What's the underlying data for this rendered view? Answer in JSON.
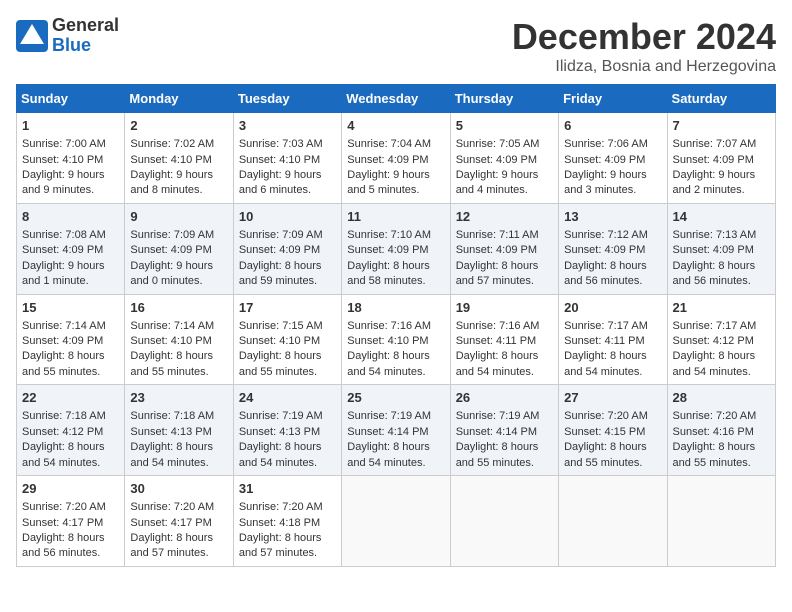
{
  "logo": {
    "general": "General",
    "blue": "Blue"
  },
  "header": {
    "month": "December 2024",
    "location": "Ilidza, Bosnia and Herzegovina"
  },
  "weekdays": [
    "Sunday",
    "Monday",
    "Tuesday",
    "Wednesday",
    "Thursday",
    "Friday",
    "Saturday"
  ],
  "weeks": [
    [
      {
        "day": 1,
        "lines": [
          "Sunrise: 7:00 AM",
          "Sunset: 4:10 PM",
          "Daylight: 9 hours",
          "and 9 minutes."
        ]
      },
      {
        "day": 2,
        "lines": [
          "Sunrise: 7:02 AM",
          "Sunset: 4:10 PM",
          "Daylight: 9 hours",
          "and 8 minutes."
        ]
      },
      {
        "day": 3,
        "lines": [
          "Sunrise: 7:03 AM",
          "Sunset: 4:10 PM",
          "Daylight: 9 hours",
          "and 6 minutes."
        ]
      },
      {
        "day": 4,
        "lines": [
          "Sunrise: 7:04 AM",
          "Sunset: 4:09 PM",
          "Daylight: 9 hours",
          "and 5 minutes."
        ]
      },
      {
        "day": 5,
        "lines": [
          "Sunrise: 7:05 AM",
          "Sunset: 4:09 PM",
          "Daylight: 9 hours",
          "and 4 minutes."
        ]
      },
      {
        "day": 6,
        "lines": [
          "Sunrise: 7:06 AM",
          "Sunset: 4:09 PM",
          "Daylight: 9 hours",
          "and 3 minutes."
        ]
      },
      {
        "day": 7,
        "lines": [
          "Sunrise: 7:07 AM",
          "Sunset: 4:09 PM",
          "Daylight: 9 hours",
          "and 2 minutes."
        ]
      }
    ],
    [
      {
        "day": 8,
        "lines": [
          "Sunrise: 7:08 AM",
          "Sunset: 4:09 PM",
          "Daylight: 9 hours",
          "and 1 minute."
        ]
      },
      {
        "day": 9,
        "lines": [
          "Sunrise: 7:09 AM",
          "Sunset: 4:09 PM",
          "Daylight: 9 hours",
          "and 0 minutes."
        ]
      },
      {
        "day": 10,
        "lines": [
          "Sunrise: 7:09 AM",
          "Sunset: 4:09 PM",
          "Daylight: 8 hours",
          "and 59 minutes."
        ]
      },
      {
        "day": 11,
        "lines": [
          "Sunrise: 7:10 AM",
          "Sunset: 4:09 PM",
          "Daylight: 8 hours",
          "and 58 minutes."
        ]
      },
      {
        "day": 12,
        "lines": [
          "Sunrise: 7:11 AM",
          "Sunset: 4:09 PM",
          "Daylight: 8 hours",
          "and 57 minutes."
        ]
      },
      {
        "day": 13,
        "lines": [
          "Sunrise: 7:12 AM",
          "Sunset: 4:09 PM",
          "Daylight: 8 hours",
          "and 56 minutes."
        ]
      },
      {
        "day": 14,
        "lines": [
          "Sunrise: 7:13 AM",
          "Sunset: 4:09 PM",
          "Daylight: 8 hours",
          "and 56 minutes."
        ]
      }
    ],
    [
      {
        "day": 15,
        "lines": [
          "Sunrise: 7:14 AM",
          "Sunset: 4:09 PM",
          "Daylight: 8 hours",
          "and 55 minutes."
        ]
      },
      {
        "day": 16,
        "lines": [
          "Sunrise: 7:14 AM",
          "Sunset: 4:10 PM",
          "Daylight: 8 hours",
          "and 55 minutes."
        ]
      },
      {
        "day": 17,
        "lines": [
          "Sunrise: 7:15 AM",
          "Sunset: 4:10 PM",
          "Daylight: 8 hours",
          "and 55 minutes."
        ]
      },
      {
        "day": 18,
        "lines": [
          "Sunrise: 7:16 AM",
          "Sunset: 4:10 PM",
          "Daylight: 8 hours",
          "and 54 minutes."
        ]
      },
      {
        "day": 19,
        "lines": [
          "Sunrise: 7:16 AM",
          "Sunset: 4:11 PM",
          "Daylight: 8 hours",
          "and 54 minutes."
        ]
      },
      {
        "day": 20,
        "lines": [
          "Sunrise: 7:17 AM",
          "Sunset: 4:11 PM",
          "Daylight: 8 hours",
          "and 54 minutes."
        ]
      },
      {
        "day": 21,
        "lines": [
          "Sunrise: 7:17 AM",
          "Sunset: 4:12 PM",
          "Daylight: 8 hours",
          "and 54 minutes."
        ]
      }
    ],
    [
      {
        "day": 22,
        "lines": [
          "Sunrise: 7:18 AM",
          "Sunset: 4:12 PM",
          "Daylight: 8 hours",
          "and 54 minutes."
        ]
      },
      {
        "day": 23,
        "lines": [
          "Sunrise: 7:18 AM",
          "Sunset: 4:13 PM",
          "Daylight: 8 hours",
          "and 54 minutes."
        ]
      },
      {
        "day": 24,
        "lines": [
          "Sunrise: 7:19 AM",
          "Sunset: 4:13 PM",
          "Daylight: 8 hours",
          "and 54 minutes."
        ]
      },
      {
        "day": 25,
        "lines": [
          "Sunrise: 7:19 AM",
          "Sunset: 4:14 PM",
          "Daylight: 8 hours",
          "and 54 minutes."
        ]
      },
      {
        "day": 26,
        "lines": [
          "Sunrise: 7:19 AM",
          "Sunset: 4:14 PM",
          "Daylight: 8 hours",
          "and 55 minutes."
        ]
      },
      {
        "day": 27,
        "lines": [
          "Sunrise: 7:20 AM",
          "Sunset: 4:15 PM",
          "Daylight: 8 hours",
          "and 55 minutes."
        ]
      },
      {
        "day": 28,
        "lines": [
          "Sunrise: 7:20 AM",
          "Sunset: 4:16 PM",
          "Daylight: 8 hours",
          "and 55 minutes."
        ]
      }
    ],
    [
      {
        "day": 29,
        "lines": [
          "Sunrise: 7:20 AM",
          "Sunset: 4:17 PM",
          "Daylight: 8 hours",
          "and 56 minutes."
        ]
      },
      {
        "day": 30,
        "lines": [
          "Sunrise: 7:20 AM",
          "Sunset: 4:17 PM",
          "Daylight: 8 hours",
          "and 57 minutes."
        ]
      },
      {
        "day": 31,
        "lines": [
          "Sunrise: 7:20 AM",
          "Sunset: 4:18 PM",
          "Daylight: 8 hours",
          "and 57 minutes."
        ]
      },
      null,
      null,
      null,
      null
    ]
  ]
}
